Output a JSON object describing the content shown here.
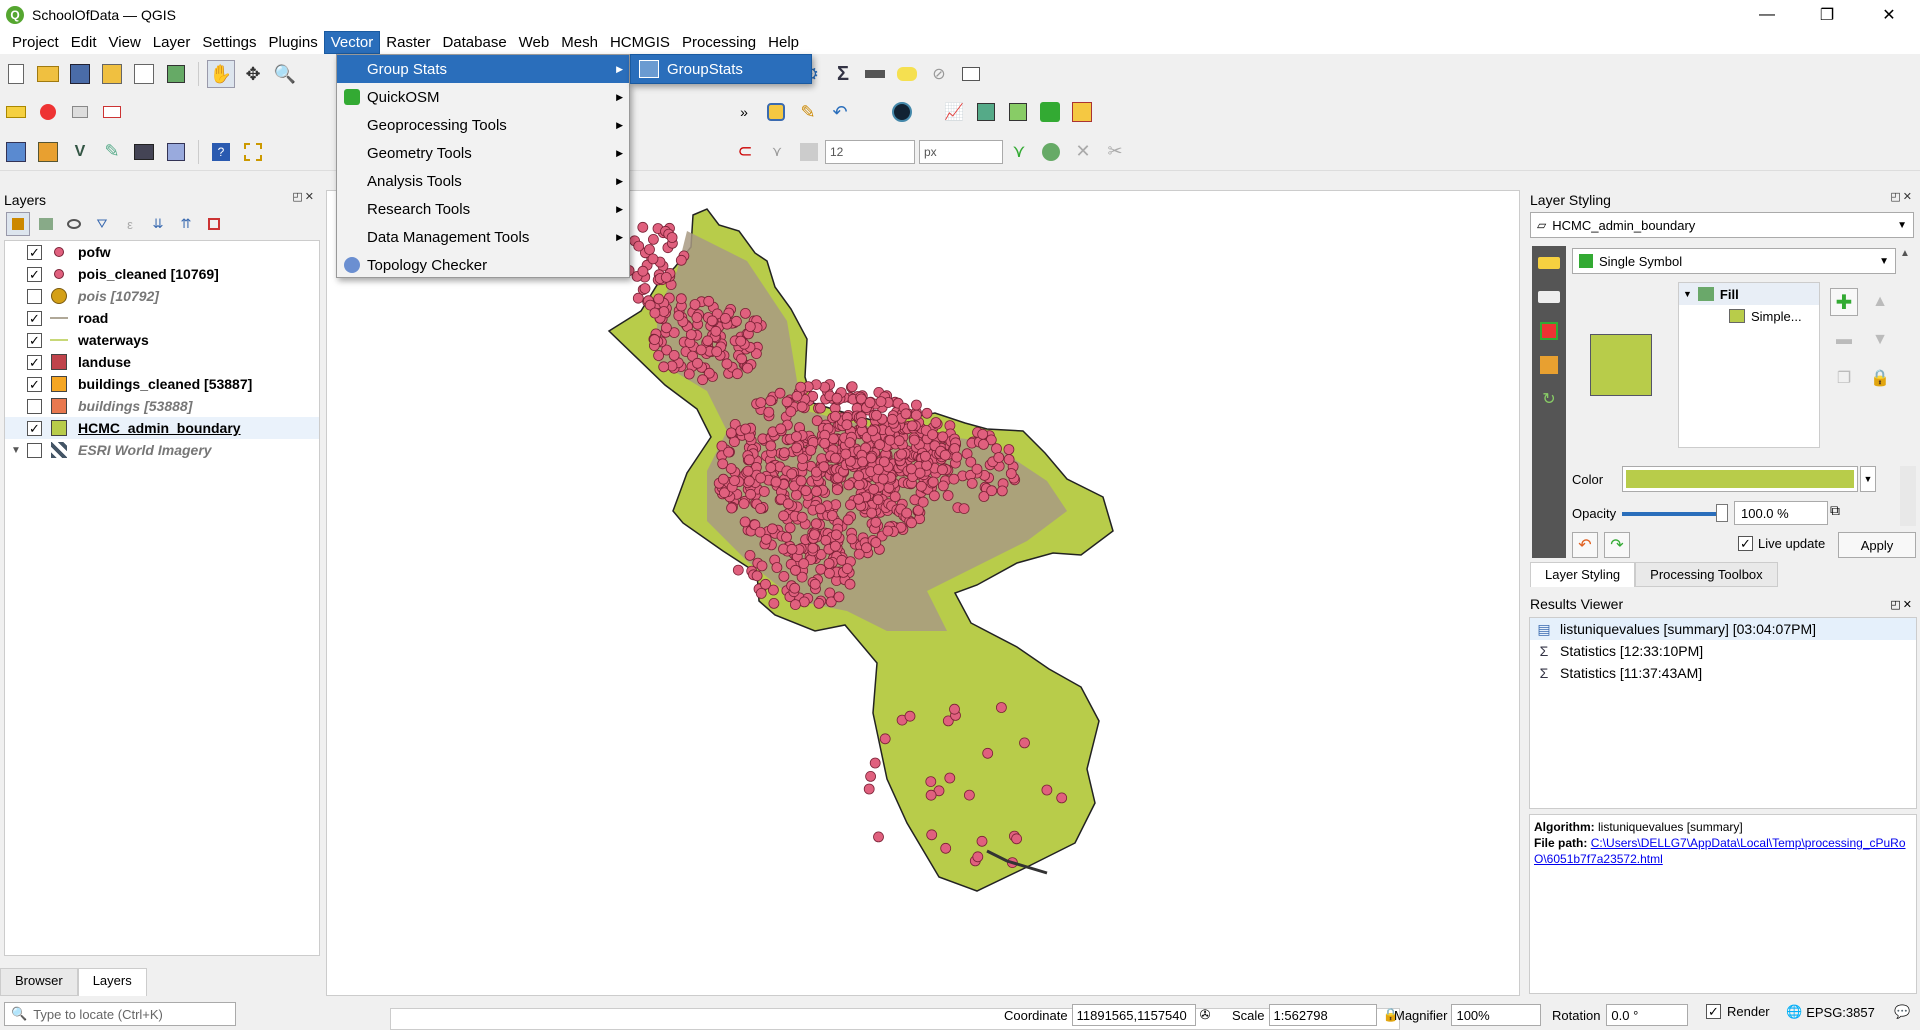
{
  "window": {
    "title": "SchoolOfData — QGIS",
    "minimize": "—",
    "restore": "❐",
    "close": "✕"
  },
  "menubar": [
    {
      "label": "Project"
    },
    {
      "label": "Edit"
    },
    {
      "label": "View"
    },
    {
      "label": "Layer"
    },
    {
      "label": "Settings"
    },
    {
      "label": "Plugins"
    },
    {
      "label": "Vector",
      "active": true
    },
    {
      "label": "Raster"
    },
    {
      "label": "Database"
    },
    {
      "label": "Web"
    },
    {
      "label": "Mesh"
    },
    {
      "label": "HCMGIS"
    },
    {
      "label": "Processing"
    },
    {
      "label": "Help"
    }
  ],
  "vector_menu": {
    "items": [
      {
        "label": "Group Stats",
        "has_submenu": true,
        "highlighted": true
      },
      {
        "label": "QuickOSM",
        "has_submenu": true,
        "icon": "quickosm-icon"
      },
      {
        "label": "Geoprocessing Tools",
        "has_submenu": true
      },
      {
        "label": "Geometry Tools",
        "has_submenu": true
      },
      {
        "label": "Analysis Tools",
        "has_submenu": true
      },
      {
        "label": "Research Tools",
        "has_submenu": true
      },
      {
        "label": "Data Management Tools",
        "has_submenu": true
      },
      {
        "label": "Topology Checker",
        "has_submenu": false,
        "icon": "topology-icon"
      }
    ],
    "submenu_item": "GroupStats"
  },
  "toolbar": {
    "font_size_value": "12",
    "unit_value": "px"
  },
  "layers_panel": {
    "title": "Layers",
    "dock_buttons": "◰✕",
    "layers": [
      {
        "name": "pofw",
        "checked": true,
        "symbol": "point-small",
        "color": "#e0607e"
      },
      {
        "name": "pois_cleaned [10769]",
        "checked": true,
        "symbol": "point-small",
        "color": "#e0607e"
      },
      {
        "name": "pois [10792]",
        "checked": false,
        "symbol": "point-large",
        "color": "#d4a017",
        "disabled": true
      },
      {
        "name": "road",
        "checked": true,
        "symbol": "line",
        "color": "#b0a898"
      },
      {
        "name": "waterways",
        "checked": true,
        "symbol": "line",
        "color": "#c8d878"
      },
      {
        "name": "landuse",
        "checked": true,
        "symbol": "fill",
        "color": "#c0434b"
      },
      {
        "name": "buildings_cleaned [53887]",
        "checked": true,
        "symbol": "fill",
        "color": "#f5a623"
      },
      {
        "name": "buildings [53888]",
        "checked": false,
        "symbol": "fill",
        "color": "#e8784f",
        "disabled": true
      },
      {
        "name": "HCMC_admin_boundary",
        "checked": true,
        "symbol": "fill",
        "color": "#b8cc4a",
        "selected": true
      },
      {
        "name": "ESRI World Imagery",
        "checked": false,
        "symbol": "raster",
        "color": "#445566",
        "disabled": true,
        "expander": true
      }
    ]
  },
  "bottom_tabs": [
    {
      "label": "Browser",
      "active": false
    },
    {
      "label": "Layers",
      "active": true
    }
  ],
  "layer_styling": {
    "title": "Layer Styling",
    "layer_name": "HCMC_admin_boundary",
    "renderer": "Single Symbol",
    "tree_root": "Fill",
    "tree_child": "Simple...",
    "fill_color": "#b8cc4a",
    "color_label": "Color",
    "opacity_label": "Opacity",
    "opacity_value": "100.0 %",
    "opacity_level": 1.0,
    "live_update_label": "Live update",
    "live_update_checked": true,
    "apply_label": "Apply",
    "tabs": [
      {
        "label": "Layer Styling",
        "active": true
      },
      {
        "label": "Processing Toolbox",
        "active": false
      }
    ]
  },
  "results_viewer": {
    "title": "Results Viewer",
    "items": [
      {
        "label": "listuniquevalues [summary] [03:04:07PM]",
        "icon": "table-icon",
        "selected": true
      },
      {
        "label": "Statistics [12:33:10PM]",
        "icon": "sigma-icon"
      },
      {
        "label": "Statistics [11:37:43AM]",
        "icon": "sigma-icon"
      }
    ],
    "info": {
      "algorithm_label": "Algorithm:",
      "algorithm_value": "listuniquevalues [summary]",
      "filepath_label": "File path:",
      "filepath_value": "C:\\Users\\DELLG7\\AppData\\Local\\Temp\\processing_cPuRoO\\6051b7f7a23572.html"
    }
  },
  "statusbar": {
    "locator_placeholder": "Type to locate (Ctrl+K)",
    "coordinate_label": "Coordinate",
    "coordinate_value": "11891565,1157540",
    "scale_label": "Scale",
    "scale_value": "1:562798",
    "magnifier_label": "Magnifier",
    "magnifier_value": "100%",
    "rotation_label": "Rotation",
    "rotation_value": "0.0 °",
    "render_label": "Render",
    "render_checked": true,
    "crs_label": "EPSG:3857"
  },
  "colors": {
    "menu_highlight": "#2a6ebb",
    "boundary_fill": "#b8cc4a",
    "landuse_fill": "#a89a82",
    "poi_fill": "#e0607e",
    "poi_stroke": "#7a2236"
  }
}
